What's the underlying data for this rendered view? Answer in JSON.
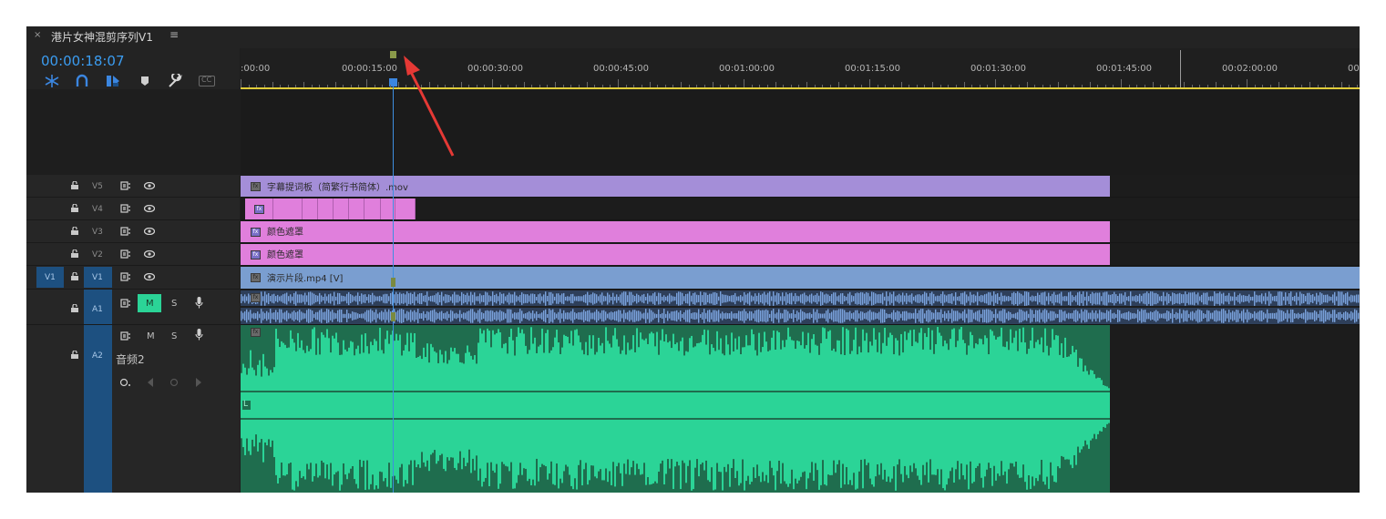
{
  "panel": {
    "close_glyph": "×",
    "title": "港片女神混剪序列V1",
    "menu_glyph": "≡",
    "timecode": "00:00:18:07"
  },
  "toolbar": {
    "icons": [
      "snap-icon",
      "linked-selection-icon",
      "insert-icon",
      "marker-icon",
      "wrench-icon",
      "captions-icon"
    ],
    "captions_label": "CC"
  },
  "ruler": {
    "labels": [
      ":00:00",
      "00:00:15:00",
      "00:00:30:00",
      "00:00:45:00",
      "00:01:00:00",
      "00:01:15:00",
      "00:01:30:00",
      "00:01:45:00",
      "00:02:00:00",
      "00"
    ]
  },
  "tracks": {
    "v5": {
      "label": "V5"
    },
    "v4": {
      "label": "V4"
    },
    "v3": {
      "label": "V3"
    },
    "v2": {
      "label": "V2"
    },
    "v1": {
      "label": "V1",
      "source_label": "V1"
    },
    "a1": {
      "label": "A1",
      "mute": "M",
      "solo": "S"
    },
    "a2": {
      "label": "A2",
      "mute": "M",
      "solo": "S",
      "name": "音频2"
    }
  },
  "clips": {
    "v5": {
      "name": "字幕提词板（简繁行书简体）.mov"
    },
    "v4": {
      "fx": "fx"
    },
    "v3": {
      "name": "颜色遮罩"
    },
    "v2": {
      "name": "颜色遮罩"
    },
    "v1": {
      "name": "演示片段.mp4 [V]"
    },
    "a2_channel": "L"
  },
  "colors": {
    "timecode": "#3b9cf0",
    "title_clip": "#a48ed8",
    "matte_clip": "#e07fdc",
    "video_clip": "#7a9ed0",
    "audio_a1": "#5576a8",
    "audio_a2": "#2bd497",
    "playhead": "#3b86e0",
    "work_bar": "#e0cc3a",
    "mute_active": "#2bd497",
    "arrow": "#e53935"
  }
}
